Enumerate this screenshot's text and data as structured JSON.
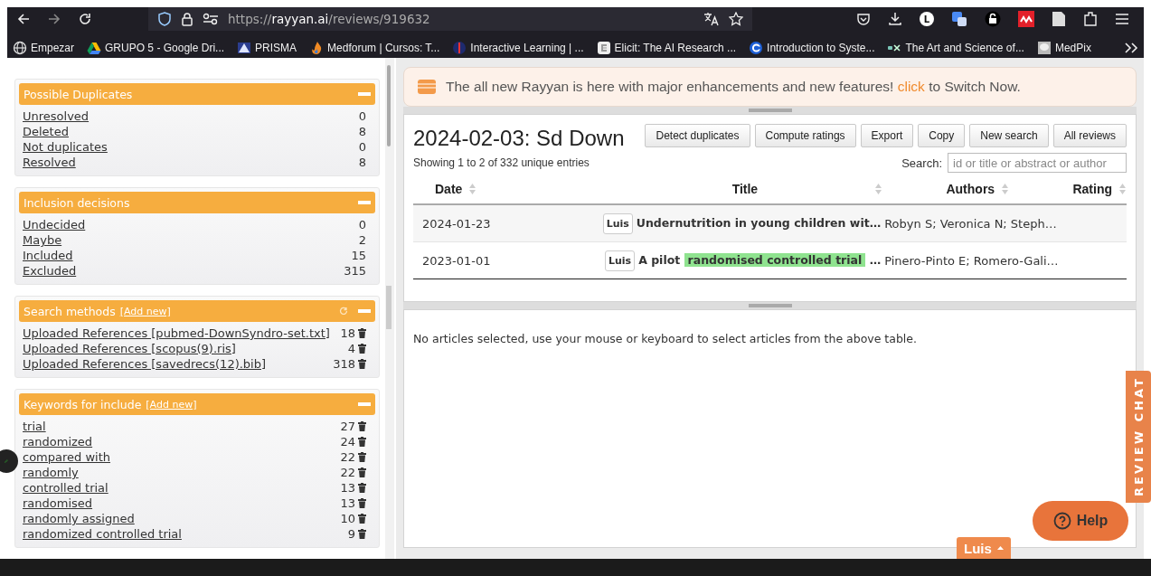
{
  "browser": {
    "url_host": "rayyan.ai",
    "url_scheme": "https://",
    "url_path": "/reviews/919632",
    "profile_initial": "L",
    "bookmarks": [
      {
        "label": "Empezar",
        "kind": "globe"
      },
      {
        "label": "GRUPO 5 - Google Dri...",
        "kind": "drive"
      },
      {
        "label": "PRISMA",
        "kind": "prisma"
      },
      {
        "label": "Medforum | Cursos: T...",
        "kind": "flame"
      },
      {
        "label": "Interactive Learning | ...",
        "kind": "orb"
      },
      {
        "label": "Elicit: The AI Research ...",
        "kind": "tile"
      },
      {
        "label": "Introduction to Syste...",
        "kind": "ring"
      },
      {
        "label": "The Art and Science of...",
        "kind": "edx"
      },
      {
        "label": "MedPix",
        "kind": "photo"
      }
    ]
  },
  "sidebar": [
    {
      "title": "Possible Duplicates",
      "refresh": false,
      "items": [
        {
          "label": "Unresolved",
          "count": "0",
          "deletable": false
        },
        {
          "label": "Deleted",
          "count": "8",
          "deletable": false
        },
        {
          "label": "Not duplicates",
          "count": "0",
          "deletable": false
        },
        {
          "label": "Resolved",
          "count": "8",
          "deletable": false
        }
      ]
    },
    {
      "title": "Inclusion decisions",
      "refresh": false,
      "items": [
        {
          "label": "Undecided",
          "count": "0",
          "deletable": false
        },
        {
          "label": "Maybe",
          "count": "2",
          "deletable": false
        },
        {
          "label": "Included",
          "count": "15",
          "deletable": false
        },
        {
          "label": "Excluded",
          "count": "315",
          "deletable": false
        }
      ]
    },
    {
      "title": "Search methods",
      "add_link": "[Add new]",
      "refresh": true,
      "items": [
        {
          "label": "Uploaded References [pubmed-DownSyndro-set.txt]",
          "count": "18",
          "deletable": true
        },
        {
          "label": "Uploaded References [scopus(9).ris]",
          "count": "4",
          "deletable": true
        },
        {
          "label": "Uploaded References [savedrecs(12).bib]",
          "count": "318",
          "deletable": true
        }
      ]
    },
    {
      "title": "Keywords for include",
      "add_link": "[Add new]",
      "refresh": false,
      "items": [
        {
          "label": "trial",
          "count": "27",
          "deletable": true
        },
        {
          "label": "randomized",
          "count": "24",
          "deletable": true
        },
        {
          "label": "compared with",
          "count": "22",
          "deletable": true
        },
        {
          "label": "randomly",
          "count": "22",
          "deletable": true
        },
        {
          "label": "controlled trial",
          "count": "13",
          "deletable": true
        },
        {
          "label": "randomised",
          "count": "13",
          "deletable": true
        },
        {
          "label": "randomly assigned",
          "count": "10",
          "deletable": true
        },
        {
          "label": "randomized controlled trial",
          "count": "9",
          "deletable": true
        }
      ]
    }
  ],
  "banner": {
    "before": "The all new Rayyan is here with major enhancements and new features!",
    "link": "click",
    "after": "to Switch Now."
  },
  "review": {
    "title": "2024-02-03: Sd Down",
    "buttons": [
      "Detect duplicates",
      "Compute ratings",
      "Export",
      "Copy",
      "New search",
      "All reviews"
    ],
    "info": "Showing 1 to 2 of 332 unique entries",
    "search_label": "Search:",
    "search_placeholder": "id or title or abstract or author",
    "columns": [
      "Date",
      "Title",
      "Authors",
      "Rating"
    ],
    "rows": [
      {
        "date": "2024-01-23",
        "tag": "Luis",
        "title": "Undernutrition in young children wit…",
        "authors": "Robyn S; Veronica N; Steph…"
      },
      {
        "date": "2023-01-01",
        "tag": "Luis",
        "title": "A pilot",
        "highlight": "randomised controlled trial",
        "tail": "…",
        "authors": "Pinero-Pinto E; Romero-Gali…"
      }
    ]
  },
  "details": {
    "message": "No articles selected, use your mouse or keyboard to select articles from the above table."
  },
  "chat_tab": "REVIEW CHAT",
  "help": "Help",
  "user_tab": "Luis"
}
